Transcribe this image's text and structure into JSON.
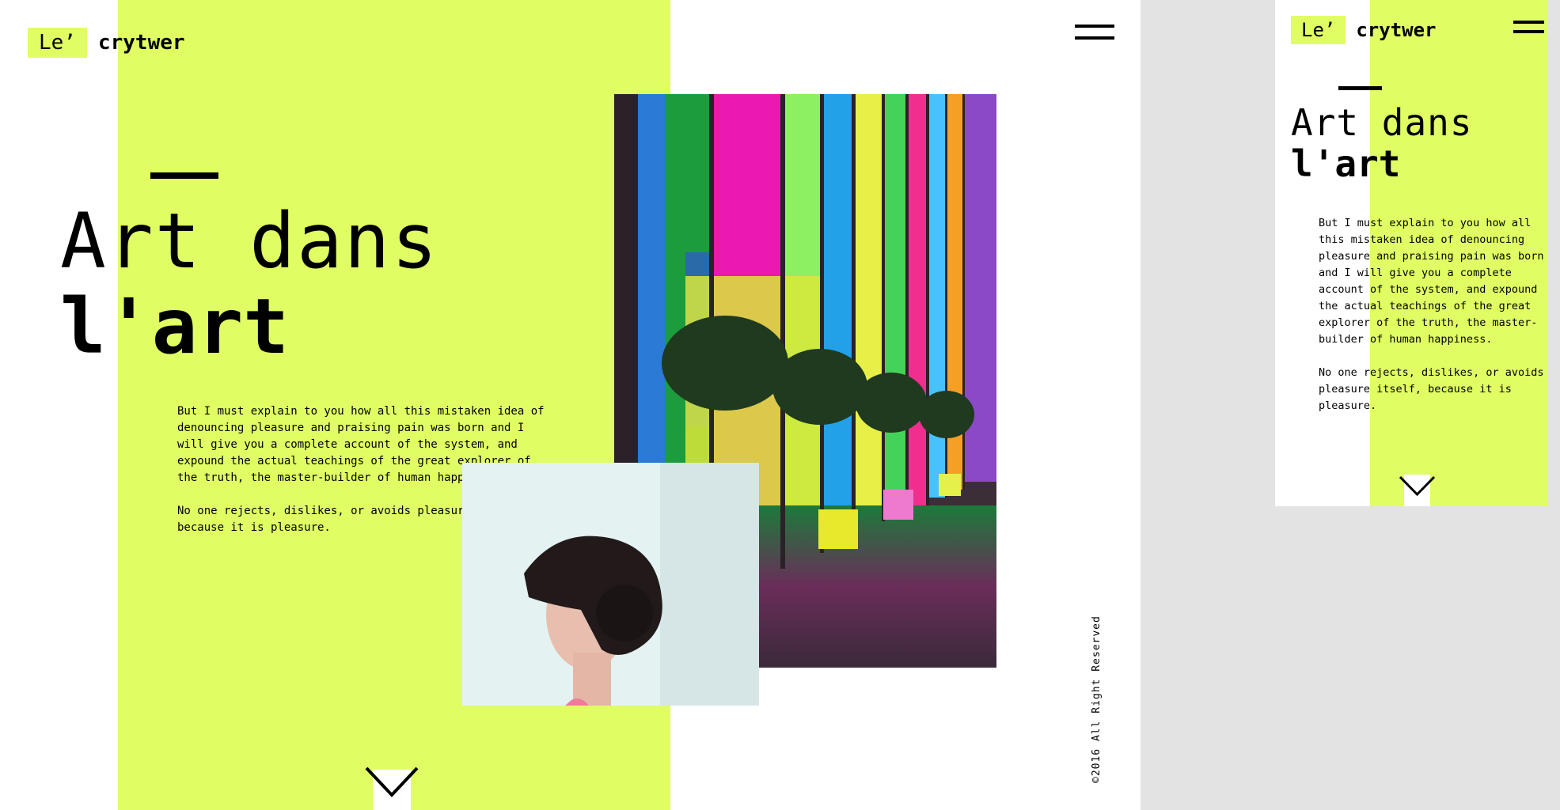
{
  "brand": {
    "prefix": "Le’",
    "name": "crytwer"
  },
  "colors": {
    "accent": "#e0fd64",
    "text": "#000000",
    "background": "#ffffff",
    "canvas": "#e3e3e3"
  },
  "hero": {
    "title_light": "Art dans",
    "title_bold": "l'art",
    "paragraphs": [
      "But I must explain to you how all this mistaken idea of denouncing pleasure and praising pain was born and I will give you a complete account of the system, and expound the actual teachings of the great explorer of the truth, the master-builder of human happiness.",
      "No one rejects, dislikes, or avoids pleasure itself, because it is pleasure."
    ]
  },
  "images": {
    "glass": "stained-glass-corridor-photo",
    "portrait": "woman-hair-bun-profile-photo"
  },
  "footer": {
    "copyright": "©2016 All Right Reserved"
  },
  "icons": {
    "menu": "hamburger-menu-icon",
    "scroll": "chevron-down-icon"
  }
}
